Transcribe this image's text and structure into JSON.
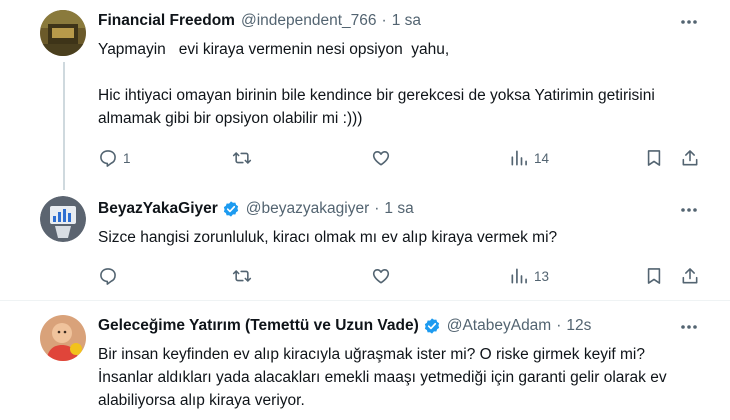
{
  "tweets": [
    {
      "name": "Financial Freedom",
      "handle": "@independent_766",
      "dot": "·",
      "time": "1 sa",
      "text": "Yapmayin   evi kiraya vermenin nesi opsiyon  yahu,\n\nHic ihtiyaci omayan birinin bile kendince bir gerekcesi de yoksa Yatirimin getirisini almamak gibi bir opsiyon olabilir mi :)))",
      "replies": "1",
      "views": "14"
    },
    {
      "name": "BeyazYakaGiyer",
      "handle": "@beyazyakagiyer",
      "dot": "·",
      "time": "1 sa",
      "text": "Sizce hangisi zorunluluk, kiracı olmak mı ev alıp kiraya vermek mi?",
      "replies": "",
      "views": "13"
    },
    {
      "name": "Geleceğime Yatırım (Temettü ve Uzun Vade)",
      "handle": "@AtabeyAdam",
      "dot": "·",
      "time": "12s",
      "text": "Bir insan keyfinden ev alıp kiracıyla uğraşmak ister mi? O riske girmek keyif mi? İnsanlar aldıkları yada alacakları emekli maaşı yetmediği için garanti gelir olarak ev alabiliyorsa alıp kiraya veriyor."
    }
  ],
  "colors": {
    "verified": "#1d9bf0",
    "muted": "#536471",
    "divider": "#eff3f4",
    "thread_line": "#cfd9de"
  },
  "icons": [
    "more-icon",
    "reply-icon",
    "retweet-icon",
    "like-icon",
    "views-icon",
    "bookmark-icon",
    "share-icon",
    "verified-badge-icon"
  ]
}
